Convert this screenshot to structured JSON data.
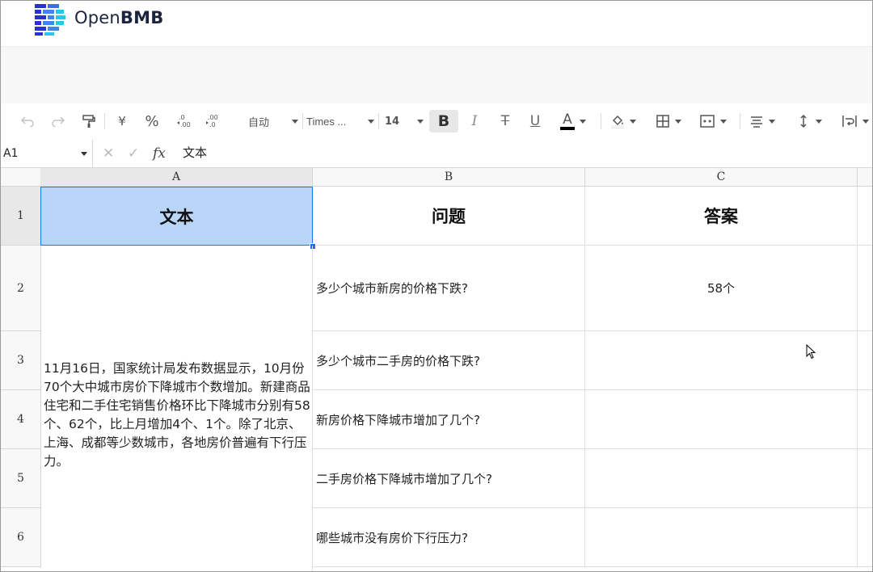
{
  "brand": {
    "light": "Open",
    "bold": "BMB",
    "colors": [
      "#2b2fd8",
      "#3d86f0",
      "#28c6e8"
    ]
  },
  "toolbar": {
    "undo_icon": "undo-icon",
    "redo_icon": "redo-icon",
    "paint_format_icon": "paint-format-icon",
    "currency": "¥",
    "percent": "%",
    "decrease_decimal": ".0←.00",
    "increase_decimal": ".00→.0",
    "number_format": "自动",
    "font_family": "Times ...",
    "font_size": "14",
    "bold": "B",
    "italic": "I",
    "strikethrough": "T",
    "underline": "U",
    "text_color": "A",
    "text_color_value": "#000000"
  },
  "formula_bar": {
    "cell_ref": "A1",
    "cancel": "✕",
    "confirm": "✓",
    "fx": "fx",
    "content": "文本"
  },
  "grid": {
    "columns": [
      "A",
      "B",
      "C"
    ],
    "rows": [
      "1",
      "2",
      "3",
      "4",
      "5",
      "6"
    ],
    "headers": {
      "a": "文本",
      "b": "问题",
      "c": "答案"
    },
    "text_cell": "11月16日，国家统计局发布数据显示，10月份70个大中城市房价下降城市个数增加。新建商品住宅和二手住宅销售价格环比下降城市分别有58个、62个，比上月增加4个、1个。除了北京、上海、成都等少数城市，各地房价普遍有下行压力。",
    "questions": [
      "多少个城市新房的价格下跌?",
      "多少个城市二手房的价格下跌?",
      "新房价格下降城市增加了几个?",
      "二手房价格下降城市增加了几个?",
      "哪些城市没有房价下行压力?"
    ],
    "answers": [
      "58个",
      "",
      "",
      "",
      ""
    ],
    "selection_color": "#b9d5f7",
    "accent": "#1a73e8"
  }
}
